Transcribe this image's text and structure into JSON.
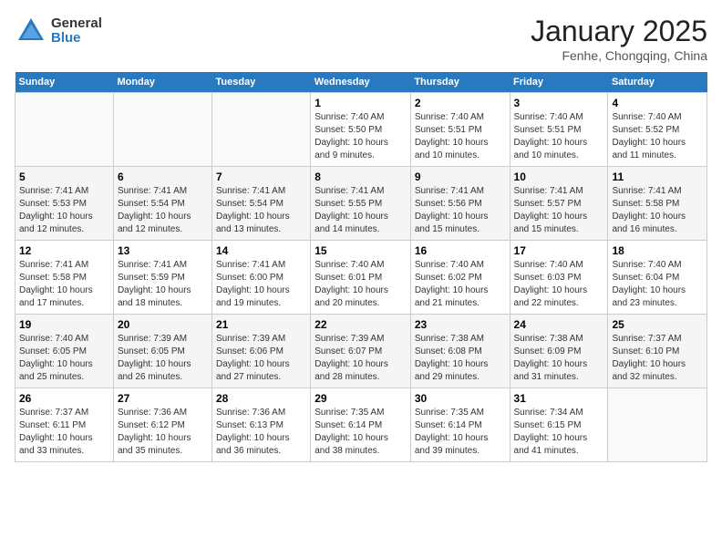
{
  "header": {
    "logo_general": "General",
    "logo_blue": "Blue",
    "title": "January 2025",
    "location": "Fenhe, Chongqing, China"
  },
  "calendar": {
    "weekdays": [
      "Sunday",
      "Monday",
      "Tuesday",
      "Wednesday",
      "Thursday",
      "Friday",
      "Saturday"
    ],
    "weeks": [
      [
        {
          "day": "",
          "info": ""
        },
        {
          "day": "",
          "info": ""
        },
        {
          "day": "",
          "info": ""
        },
        {
          "day": "1",
          "info": "Sunrise: 7:40 AM\nSunset: 5:50 PM\nDaylight: 10 hours\nand 9 minutes."
        },
        {
          "day": "2",
          "info": "Sunrise: 7:40 AM\nSunset: 5:51 PM\nDaylight: 10 hours\nand 10 minutes."
        },
        {
          "day": "3",
          "info": "Sunrise: 7:40 AM\nSunset: 5:51 PM\nDaylight: 10 hours\nand 10 minutes."
        },
        {
          "day": "4",
          "info": "Sunrise: 7:40 AM\nSunset: 5:52 PM\nDaylight: 10 hours\nand 11 minutes."
        }
      ],
      [
        {
          "day": "5",
          "info": "Sunrise: 7:41 AM\nSunset: 5:53 PM\nDaylight: 10 hours\nand 12 minutes."
        },
        {
          "day": "6",
          "info": "Sunrise: 7:41 AM\nSunset: 5:54 PM\nDaylight: 10 hours\nand 12 minutes."
        },
        {
          "day": "7",
          "info": "Sunrise: 7:41 AM\nSunset: 5:54 PM\nDaylight: 10 hours\nand 13 minutes."
        },
        {
          "day": "8",
          "info": "Sunrise: 7:41 AM\nSunset: 5:55 PM\nDaylight: 10 hours\nand 14 minutes."
        },
        {
          "day": "9",
          "info": "Sunrise: 7:41 AM\nSunset: 5:56 PM\nDaylight: 10 hours\nand 15 minutes."
        },
        {
          "day": "10",
          "info": "Sunrise: 7:41 AM\nSunset: 5:57 PM\nDaylight: 10 hours\nand 15 minutes."
        },
        {
          "day": "11",
          "info": "Sunrise: 7:41 AM\nSunset: 5:58 PM\nDaylight: 10 hours\nand 16 minutes."
        }
      ],
      [
        {
          "day": "12",
          "info": "Sunrise: 7:41 AM\nSunset: 5:58 PM\nDaylight: 10 hours\nand 17 minutes."
        },
        {
          "day": "13",
          "info": "Sunrise: 7:41 AM\nSunset: 5:59 PM\nDaylight: 10 hours\nand 18 minutes."
        },
        {
          "day": "14",
          "info": "Sunrise: 7:41 AM\nSunset: 6:00 PM\nDaylight: 10 hours\nand 19 minutes."
        },
        {
          "day": "15",
          "info": "Sunrise: 7:40 AM\nSunset: 6:01 PM\nDaylight: 10 hours\nand 20 minutes."
        },
        {
          "day": "16",
          "info": "Sunrise: 7:40 AM\nSunset: 6:02 PM\nDaylight: 10 hours\nand 21 minutes."
        },
        {
          "day": "17",
          "info": "Sunrise: 7:40 AM\nSunset: 6:03 PM\nDaylight: 10 hours\nand 22 minutes."
        },
        {
          "day": "18",
          "info": "Sunrise: 7:40 AM\nSunset: 6:04 PM\nDaylight: 10 hours\nand 23 minutes."
        }
      ],
      [
        {
          "day": "19",
          "info": "Sunrise: 7:40 AM\nSunset: 6:05 PM\nDaylight: 10 hours\nand 25 minutes."
        },
        {
          "day": "20",
          "info": "Sunrise: 7:39 AM\nSunset: 6:05 PM\nDaylight: 10 hours\nand 26 minutes."
        },
        {
          "day": "21",
          "info": "Sunrise: 7:39 AM\nSunset: 6:06 PM\nDaylight: 10 hours\nand 27 minutes."
        },
        {
          "day": "22",
          "info": "Sunrise: 7:39 AM\nSunset: 6:07 PM\nDaylight: 10 hours\nand 28 minutes."
        },
        {
          "day": "23",
          "info": "Sunrise: 7:38 AM\nSunset: 6:08 PM\nDaylight: 10 hours\nand 29 minutes."
        },
        {
          "day": "24",
          "info": "Sunrise: 7:38 AM\nSunset: 6:09 PM\nDaylight: 10 hours\nand 31 minutes."
        },
        {
          "day": "25",
          "info": "Sunrise: 7:37 AM\nSunset: 6:10 PM\nDaylight: 10 hours\nand 32 minutes."
        }
      ],
      [
        {
          "day": "26",
          "info": "Sunrise: 7:37 AM\nSunset: 6:11 PM\nDaylight: 10 hours\nand 33 minutes."
        },
        {
          "day": "27",
          "info": "Sunrise: 7:36 AM\nSunset: 6:12 PM\nDaylight: 10 hours\nand 35 minutes."
        },
        {
          "day": "28",
          "info": "Sunrise: 7:36 AM\nSunset: 6:13 PM\nDaylight: 10 hours\nand 36 minutes."
        },
        {
          "day": "29",
          "info": "Sunrise: 7:35 AM\nSunset: 6:14 PM\nDaylight: 10 hours\nand 38 minutes."
        },
        {
          "day": "30",
          "info": "Sunrise: 7:35 AM\nSunset: 6:14 PM\nDaylight: 10 hours\nand 39 minutes."
        },
        {
          "day": "31",
          "info": "Sunrise: 7:34 AM\nSunset: 6:15 PM\nDaylight: 10 hours\nand 41 minutes."
        },
        {
          "day": "",
          "info": ""
        }
      ]
    ]
  }
}
